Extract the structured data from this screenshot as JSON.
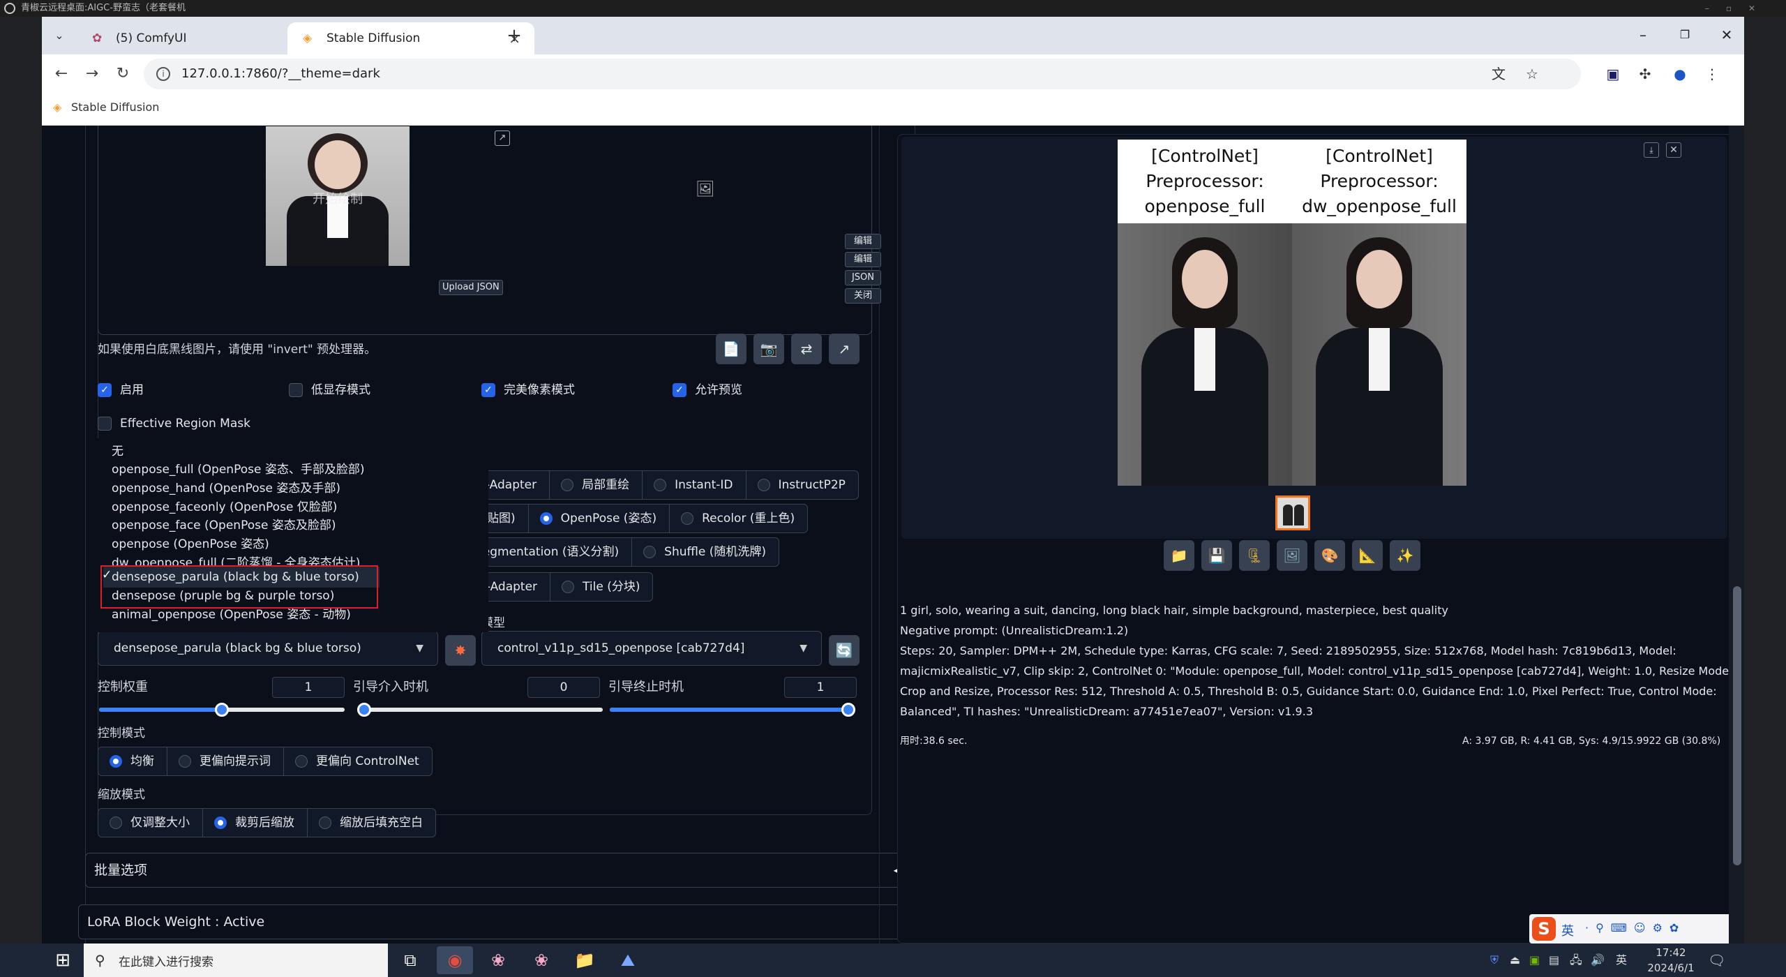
{
  "remote_title": "青椒云远程桌面:AIGC-野蛮志（老套餐机",
  "tabs": [
    {
      "label": "(5) ComfyUI"
    },
    {
      "label": "Stable Diffusion"
    }
  ],
  "url": "127.0.0.1:7860/?__theme=dark",
  "bookmark": "Stable Diffusion",
  "canvas": {
    "overlay_text": "开始绘制",
    "upload_json": "Upload JSON",
    "side_buttons": [
      "编辑",
      "编辑",
      "JSON",
      "关闭"
    ]
  },
  "hint_text": "如果使用白底黑线图片，请使用 \"invert\" 预处理器。",
  "checkboxes": [
    {
      "label": "启用",
      "checked": true
    },
    {
      "label": "低显存模式",
      "checked": false
    },
    {
      "label": "完美像素模式",
      "checked": true
    },
    {
      "label": "允许预览",
      "checked": true
    }
  ],
  "effective_region_mask": {
    "label": "Effective Region Mask",
    "checked": false
  },
  "control_type_rows": [
    [
      "IP-Adapter",
      "局部重绘",
      "Instant-ID",
      "InstructP2P"
    ],
    [
      "线贴图)",
      "OpenPose (姿态)",
      "Recolor (重上色)"
    ],
    [
      "Segmentation (语义分割)",
      "Shuffle (随机洗牌)"
    ],
    [
      "2I-Adapter",
      "Tile (分块)"
    ]
  ],
  "selected_control_type": "OpenPose (姿态)",
  "preprocessor_dropdown": {
    "items": [
      "无",
      "openpose_full (OpenPose 姿态、手部及脸部)",
      "openpose_hand (OpenPose 姿态及手部)",
      "openpose_faceonly (OpenPose 仅脸部)",
      "openpose_face (OpenPose 姿态及脸部)",
      "openpose (OpenPose 姿态)",
      "dw_openpose_full (二阶蒸馏 - 全身姿态估计)",
      "densepose_parula (black bg & blue torso)",
      "densepose (pruple bg & purple torso)",
      "animal_openpose (OpenPose 姿态 - 动物)"
    ],
    "checked": "densepose_parula (black bg & blue torso)",
    "check_mark": "✓"
  },
  "model_label": "模型",
  "preprocessor_value": "densepose_parula (black bg & blue torso)",
  "model_value": "control_v11p_sd15_openpose [cab727d4]",
  "sliders": [
    {
      "label": "控制权重",
      "value": "1",
      "fraction": 0.5
    },
    {
      "label": "引导介入时机",
      "value": "0",
      "fraction": 0.0
    },
    {
      "label": "引导终止时机",
      "value": "1",
      "fraction": 1.0
    }
  ],
  "control_mode": {
    "label": "控制模式",
    "options": [
      "均衡",
      "更偏向提示词",
      "更偏向 ControlNet"
    ],
    "selected": "均衡"
  },
  "resize_mode": {
    "label": "缩放模式",
    "options": [
      "仅调整大小",
      "裁剪后缩放",
      "缩放后填充空白"
    ],
    "selected": "裁剪后缩放"
  },
  "batch_options": "批量选项",
  "lora_block": "LoRA Block Weight : Active",
  "result": {
    "col1": [
      "[ControlNet]",
      "Preprocessor:",
      "openpose_full"
    ],
    "col2": [
      "[ControlNet]",
      "Preprocessor:",
      "dw_openpose_full"
    ]
  },
  "image_tools": [
    "folder-icon",
    "save-icon",
    "zip-icon",
    "image-icon",
    "palette-icon",
    "ruler-icon",
    "sparkle-icon"
  ],
  "prompt": "1 girl, solo, wearing a suit, dancing, long black hair, simple background, masterpiece, best quality",
  "negative_prompt": "Negative prompt: (UnrealisticDream:1.2)",
  "params_lines": [
    "Steps: 20, Sampler: DPM++ 2M, Schedule type: Karras, CFG scale: 7, Seed: 2189502955, Size: 512x768, Model hash: 7c819b6d13, Model:",
    "majicmixRealistic_v7, Clip skip: 2, ControlNet 0: \"Module: openpose_full, Model: control_v11p_sd15_openpose [cab727d4], Weight: 1.0, Resize Mode:",
    "Crop and Resize, Processor Res: 512, Threshold A: 0.5, Threshold B: 0.5, Guidance Start: 0.0, Guidance End: 1.0, Pixel Perfect: True, Control Mode:",
    "Balanced\", TI hashes: \"UnrealisticDream: a77451e7ea07\", Version: v1.9.3"
  ],
  "time_used": "用时:38.6 sec.",
  "memory": "A: 3.97 GB, R: 4.41 GB, Sys: 4.9/15.9922 GB (30.8%)",
  "taskbar": {
    "search_placeholder": "在此键入进行搜索",
    "ime": "英",
    "ime2": "英",
    "time": "17:42",
    "date": "2024/6/1"
  },
  "colors": {
    "accent": "#2563eb",
    "dark_bg": "#0b0f19",
    "highlight_border": "#e11d2a"
  }
}
